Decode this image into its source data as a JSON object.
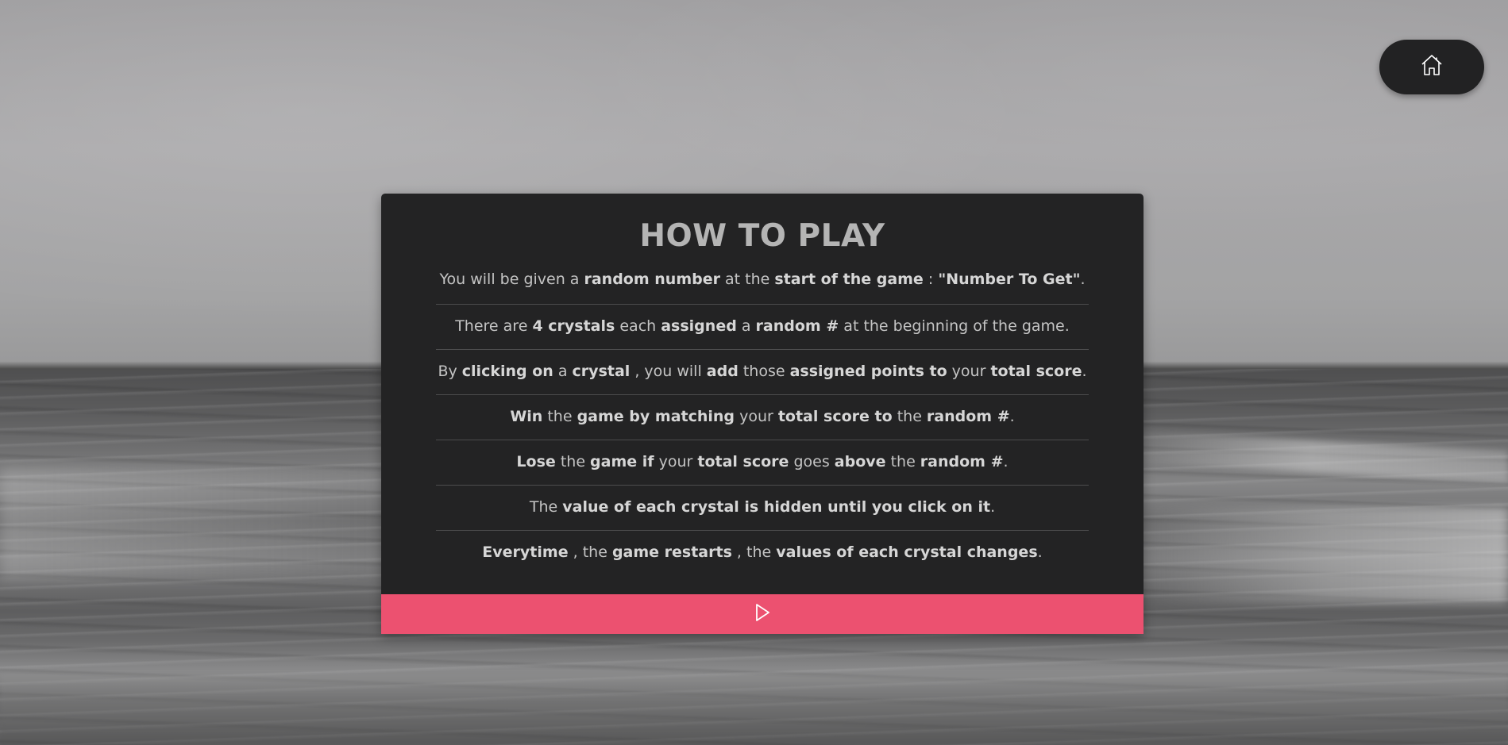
{
  "home_button": {
    "icon": "home-icon"
  },
  "card": {
    "title": "HOW TO PLAY",
    "rules": [
      [
        {
          "t": "You will be given a "
        },
        {
          "t": "random number",
          "b": true
        },
        {
          "t": " at the "
        },
        {
          "t": "start of the game",
          "b": true
        },
        {
          "t": " : "
        },
        {
          "t": "\"Number To Get\"",
          "b": true
        },
        {
          "t": "."
        }
      ],
      [
        {
          "t": "There are "
        },
        {
          "t": "4 crystals",
          "b": true
        },
        {
          "t": " each "
        },
        {
          "t": "assigned",
          "b": true
        },
        {
          "t": " a "
        },
        {
          "t": "random #",
          "b": true
        },
        {
          "t": " at the beginning of the game."
        }
      ],
      [
        {
          "t": "By "
        },
        {
          "t": "clicking on",
          "b": true
        },
        {
          "t": " a "
        },
        {
          "t": "crystal",
          "b": true
        },
        {
          "t": " , you will "
        },
        {
          "t": "add",
          "b": true
        },
        {
          "t": " those "
        },
        {
          "t": "assigned points to",
          "b": true
        },
        {
          "t": " your "
        },
        {
          "t": "total score",
          "b": true
        },
        {
          "t": "."
        }
      ],
      [
        {
          "t": "Win",
          "b": true
        },
        {
          "t": " the "
        },
        {
          "t": "game by matching",
          "b": true
        },
        {
          "t": " your "
        },
        {
          "t": "total score to",
          "b": true
        },
        {
          "t": " the "
        },
        {
          "t": "random #",
          "b": true
        },
        {
          "t": "."
        }
      ],
      [
        {
          "t": "Lose",
          "b": true
        },
        {
          "t": " the "
        },
        {
          "t": "game if",
          "b": true
        },
        {
          "t": " your "
        },
        {
          "t": "total score",
          "b": true
        },
        {
          "t": " goes "
        },
        {
          "t": "above",
          "b": true
        },
        {
          "t": " the "
        },
        {
          "t": "random #",
          "b": true
        },
        {
          "t": "."
        }
      ],
      [
        {
          "t": "The "
        },
        {
          "t": "value of each crystal is hidden until you click on it",
          "b": true
        },
        {
          "t": "."
        }
      ],
      [
        {
          "t": "Everytime",
          "b": true
        },
        {
          "t": " , the "
        },
        {
          "t": "game restarts",
          "b": true
        },
        {
          "t": " , the "
        },
        {
          "t": "values of each crystal changes",
          "b": true
        },
        {
          "t": "."
        }
      ]
    ]
  },
  "play_button": {
    "icon": "play-icon",
    "color": "#ec5170"
  },
  "colors": {
    "card_bg": "#232324",
    "title": "#b4b4b4",
    "text": "#c4c4c4"
  }
}
